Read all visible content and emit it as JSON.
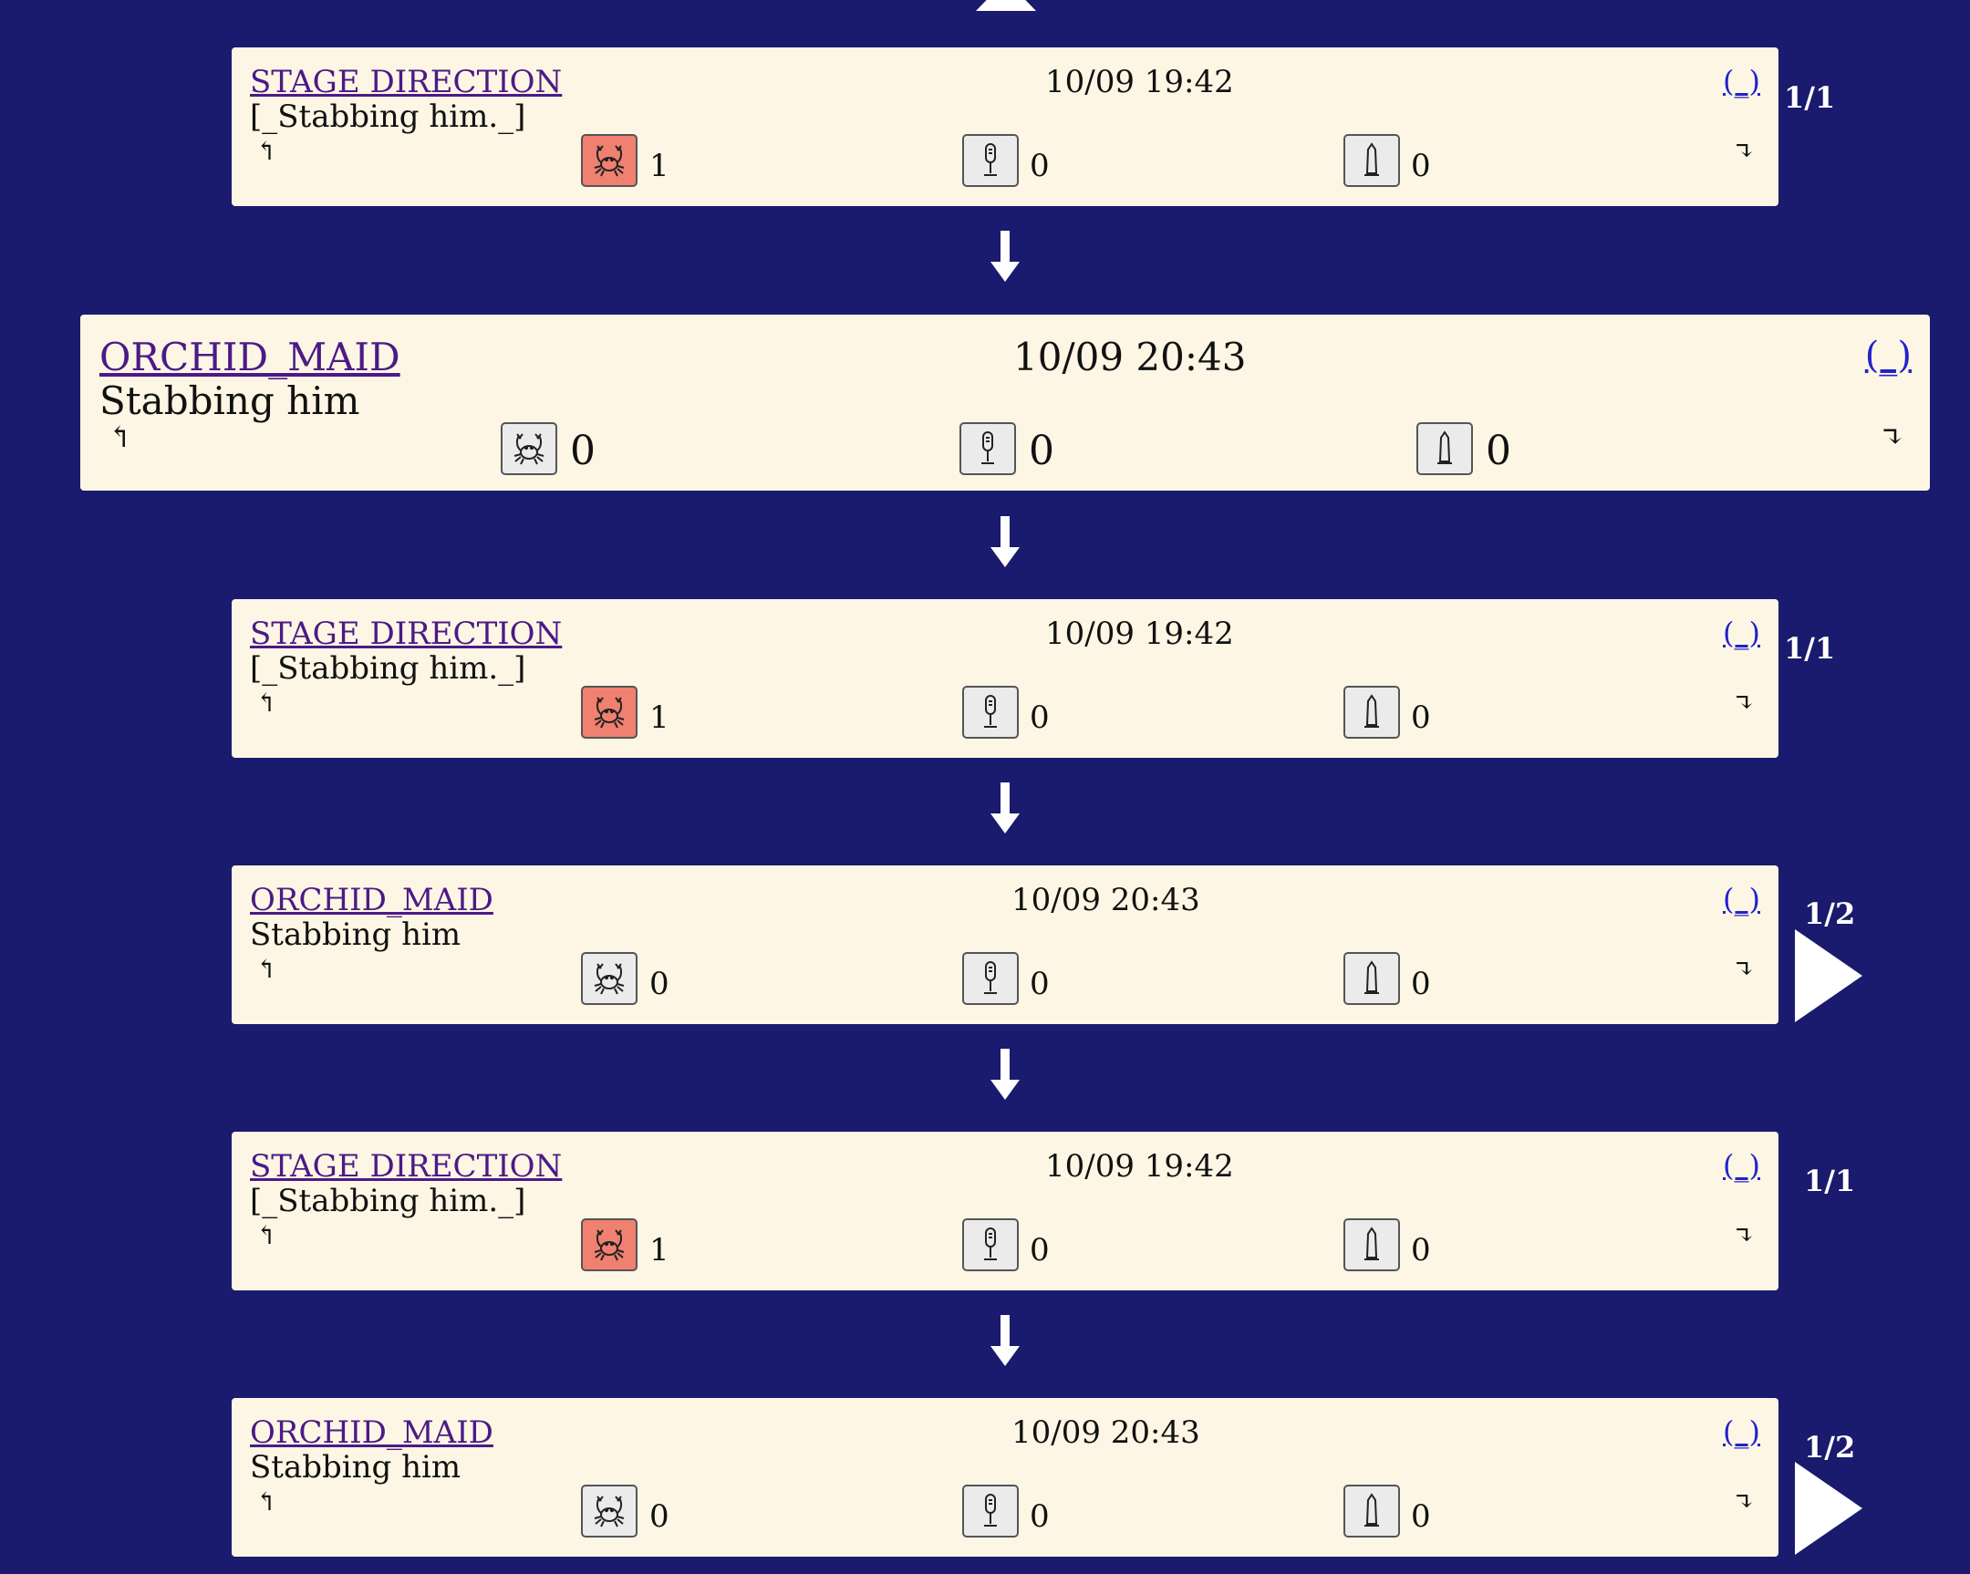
{
  "cards": [
    {
      "author": "STAGE DIRECTION",
      "time": "10/09 19:42",
      "text": "[_Stabbing him._]",
      "edit": "(_)",
      "reactions": [
        1,
        0,
        0
      ],
      "crab_active": true,
      "page": "1/1",
      "has_next": false
    },
    {
      "author": "ORCHID_MAID",
      "time": "10/09 20:43",
      "text": "Stabbing him",
      "edit": "(_)",
      "reactions": [
        0,
        0,
        0
      ],
      "crab_active": false,
      "page": "",
      "has_next": false
    },
    {
      "author": "STAGE DIRECTION",
      "time": "10/09 19:42",
      "text": "[_Stabbing him._]",
      "edit": "(_)",
      "reactions": [
        1,
        0,
        0
      ],
      "crab_active": true,
      "page": "1/1",
      "has_next": false
    },
    {
      "author": "ORCHID_MAID",
      "time": "10/09 20:43",
      "text": "Stabbing him",
      "edit": "(_)",
      "reactions": [
        0,
        0,
        0
      ],
      "crab_active": false,
      "page": "1/2",
      "has_next": true
    },
    {
      "author": "STAGE DIRECTION",
      "time": "10/09 19:42",
      "text": "[_Stabbing him._]",
      "edit": "(_)",
      "reactions": [
        1,
        0,
        0
      ],
      "crab_active": true,
      "page": "1/1",
      "has_next": false
    },
    {
      "author": "ORCHID_MAID",
      "time": "10/09 20:43",
      "text": "Stabbing him",
      "edit": "(_)",
      "reactions": [
        0,
        0,
        0
      ],
      "crab_active": false,
      "page": "1/2",
      "has_next": true
    }
  ],
  "nav": {
    "prev_glyph": "↰",
    "next_glyph": "↴"
  },
  "reaction_icons": [
    "crab-icon",
    "microphone-icon",
    "obelisk-icon"
  ],
  "colors": {
    "background": "#1a1a6e",
    "card": "#fdf6e4",
    "author_link": "#4b1a87",
    "edit_link": "#2222cc",
    "reaction_active": "#f08070",
    "reaction_idle": "#ebebeb"
  }
}
